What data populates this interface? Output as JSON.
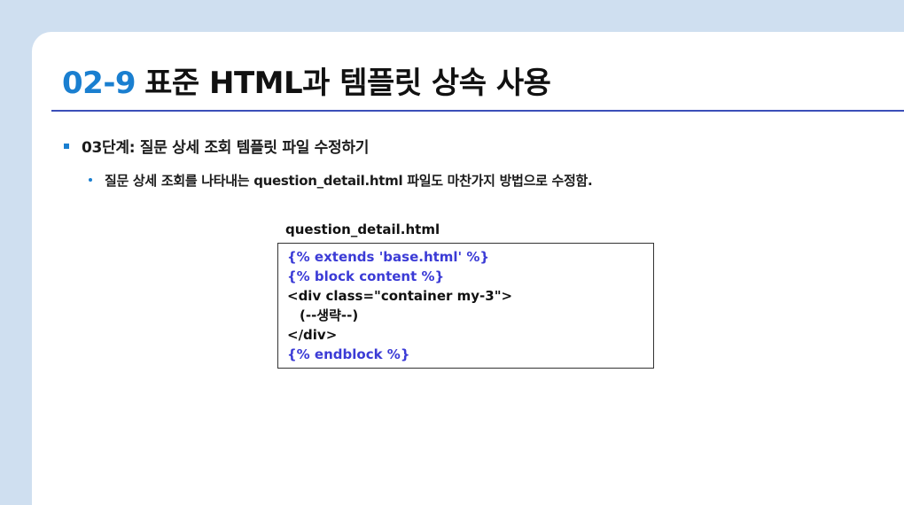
{
  "slide": {
    "title_number": "02-9",
    "title_text": "표준 HTML과 템플릿 상속 사용",
    "bullet_level1": "03단계: 질문 상세 조회 템플릿 파일 수정하기",
    "bullet_level2": "질문 상세 조회를 나타내는 question_detail.html 파일도 마찬가지 방법으로 수정함.",
    "file_name": "question_detail.html",
    "code_lines": [
      "{% extends 'base.html' %}",
      "{% block content %}",
      "<div class=\"container my-3\">",
      "(--생략--)",
      "</div>",
      "{% endblock %}"
    ]
  },
  "colors": {
    "background": "#cfdff0",
    "accent_blue": "#1a7fd0",
    "rule_blue": "#3b4fb8",
    "template_tag": "#3b3bd6"
  }
}
